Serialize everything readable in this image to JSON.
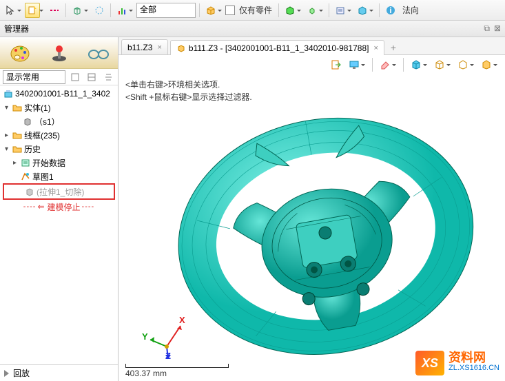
{
  "toolbar": {
    "filter_all": "全部",
    "parts_only": "仅有零件",
    "direction": "法向"
  },
  "manager": {
    "title": "管理器"
  },
  "display_mode": {
    "label": "显示常用"
  },
  "tree": {
    "root": "3402001001-B11_1_3402",
    "entity_folder": "实体(1)",
    "entity_item": "（s1）",
    "wire_folder": "线框(235)",
    "history_folder": "历史",
    "start_data": "开始数据",
    "sketch1": "草图1",
    "extrude_cut": "(拉伸1_切除)",
    "model_stop": "建模停止"
  },
  "replay": {
    "label": "回放"
  },
  "tabs": {
    "tab1": "b11.Z3",
    "tab2": "b111.Z3 - [3402001001-B11_1_3402010-981788]"
  },
  "canvas": {
    "hint1": "<单击右键>环境相关选项.",
    "hint2": "<Shift +鼠标右键>显示选择过滤器.",
    "ruler": "403.37 mm",
    "axis_x": "X",
    "axis_y": "Y",
    "axis_z": "Z"
  },
  "watermark": {
    "logo": "XS",
    "cn": "资料网",
    "url": "ZL.XS1616.CN"
  },
  "icons": {
    "cursor": "cursor-icon",
    "newdoc": "new-doc-icon",
    "dash": "dash-icon",
    "cube": "cube-icon",
    "circle": "circle-icon",
    "bars": "bars-icon",
    "box3d": "box3d-icon",
    "greencube": "green-cube-icon",
    "minicube": "mini-cube-icon",
    "sheet": "sheet-icon",
    "bluecube": "blue-cube-icon",
    "info": "info-icon",
    "palette": "palette-icon",
    "joystick": "joystick-icon",
    "glasses": "glasses-icon",
    "part": "part-icon",
    "folder": "folder-icon",
    "solid": "solid-icon",
    "sketch": "sketch-icon",
    "feature": "feature-icon",
    "detach": "detach-icon",
    "close": "close-icon",
    "exit": "exit-icon",
    "display": "display-icon",
    "eraser": "eraser-icon",
    "wirecube": "wirecube-icon",
    "shaded": "shaded-icon",
    "iso": "iso-icon"
  }
}
